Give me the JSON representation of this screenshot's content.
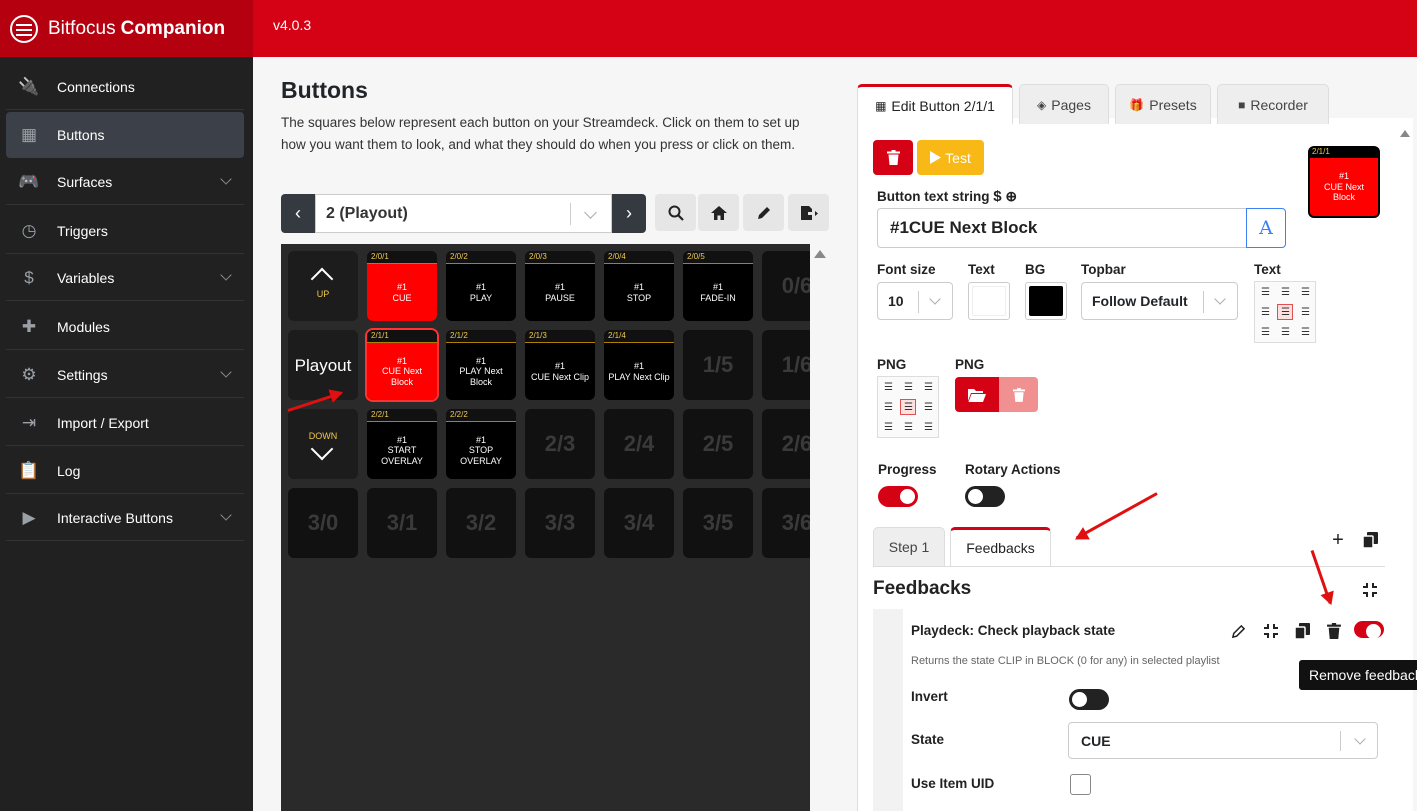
{
  "app": {
    "brand_light": "Bitfocus",
    "brand_bold": "Companion",
    "version": "v4.0.3"
  },
  "sidebar": {
    "items": [
      {
        "label": "Connections",
        "icon": "plug-icon"
      },
      {
        "label": "Buttons",
        "icon": "grid-icon",
        "active": true
      },
      {
        "label": "Surfaces",
        "icon": "gamepad-icon",
        "expandable": true
      },
      {
        "label": "Triggers",
        "icon": "clock-icon"
      },
      {
        "label": "Variables",
        "icon": "dollar-icon",
        "expandable": true
      },
      {
        "label": "Modules",
        "icon": "puzzle-icon"
      },
      {
        "label": "Settings",
        "icon": "gear-icon",
        "expandable": true
      },
      {
        "label": "Import / Export",
        "icon": "file-import-icon"
      },
      {
        "label": "Log",
        "icon": "clipboard-icon"
      },
      {
        "label": "Interactive Buttons",
        "icon": "play-square-icon",
        "expandable": true
      }
    ]
  },
  "buttons_page": {
    "title": "Buttons",
    "description": "The squares below represent each button on your Streamdeck. Click on them to set up how you want them to look, and what they should do when you press or click on them.",
    "page_select": "2 (Playout)"
  },
  "grid": {
    "nav": {
      "up": "UP",
      "page_name": "Playout",
      "down": "DOWN"
    },
    "buttons": [
      {
        "id": "2/0/1",
        "text": "#1\nCUE",
        "red": true
      },
      {
        "id": "2/0/2",
        "text": "#1\nPLAY"
      },
      {
        "id": "2/0/3",
        "text": "#1\nPAUSE"
      },
      {
        "id": "2/0/4",
        "text": "#1\nSTOP"
      },
      {
        "id": "2/0/5",
        "text": "#1\nFADE-IN"
      },
      {
        "id": "2/1/1",
        "text": "#1\nCUE Next\nBlock",
        "red": true,
        "selected": true
      },
      {
        "id": "2/1/2",
        "text": "#1\nPLAY Next\nBlock"
      },
      {
        "id": "2/1/3",
        "text": "#1\nCUE Next Clip"
      },
      {
        "id": "2/1/4",
        "text": "#1\nPLAY Next Clip"
      },
      {
        "id": "2/2/1",
        "text": "#1\nSTART\nOVERLAY"
      },
      {
        "id": "2/2/2",
        "text": "#1\nSTOP\nOVERLAY"
      }
    ],
    "empty": [
      "0/6",
      "1/5",
      "1/6",
      "2/3",
      "2/4",
      "2/5",
      "2/6",
      "3/0",
      "3/1",
      "3/2",
      "3/3",
      "3/4",
      "3/5",
      "3/6"
    ]
  },
  "editor": {
    "tabs": [
      "Edit Button 2/1/1",
      "Pages",
      "Presets",
      "Recorder"
    ],
    "test_label": "Test",
    "preview": {
      "id": "2/1/1",
      "text": "#1\nCUE Next\nBlock"
    },
    "text_string_label": "Button text string",
    "text_string_value": "#1CUE Next Block",
    "font_size_label": "Font size",
    "font_size_value": "10",
    "text_color_label": "Text",
    "bg_label": "BG",
    "topbar_label": "Topbar",
    "topbar_value": "Follow Default",
    "text_align_label": "Text",
    "png_align_label": "PNG",
    "png_label": "PNG",
    "progress_label": "Progress",
    "rotary_label": "Rotary Actions",
    "colors": {
      "text": "#ffffff",
      "bg": "#000000",
      "accent": "#d50215"
    },
    "sub_tabs": [
      "Step 1",
      "Feedbacks"
    ],
    "feedbacks": {
      "heading": "Feedbacks",
      "item_title": "Playdeck: Check playback state",
      "item_desc": "Returns the state CLIP in BLOCK (0 for any) in selected playlist",
      "tooltip": "Remove feedback",
      "invert_label": "Invert",
      "state_label": "State",
      "state_value": "CUE",
      "uid_label": "Use Item UID"
    }
  }
}
